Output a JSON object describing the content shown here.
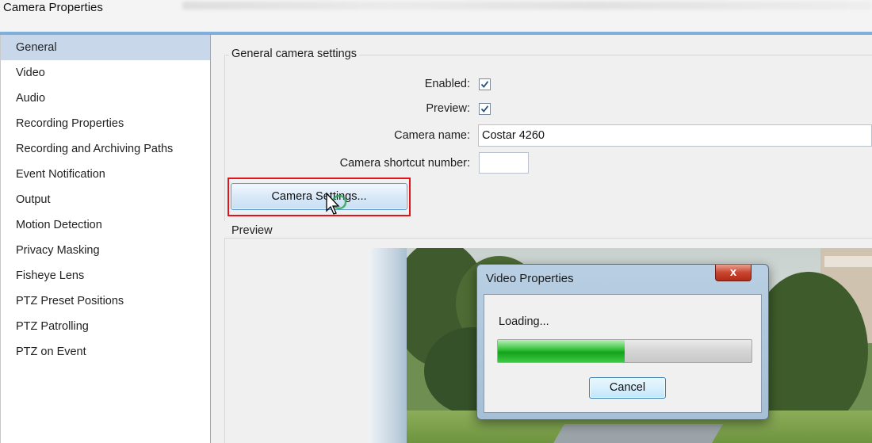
{
  "window": {
    "title": "Camera Properties"
  },
  "sidebar": {
    "items": [
      {
        "label": "General"
      },
      {
        "label": "Video"
      },
      {
        "label": "Audio"
      },
      {
        "label": "Recording Properties"
      },
      {
        "label": "Recording and Archiving Paths"
      },
      {
        "label": "Event Notification"
      },
      {
        "label": "Output"
      },
      {
        "label": "Motion Detection"
      },
      {
        "label": "Privacy Masking"
      },
      {
        "label": "Fisheye Lens"
      },
      {
        "label": "PTZ Preset Positions"
      },
      {
        "label": "PTZ Patrolling"
      },
      {
        "label": "PTZ on Event"
      }
    ],
    "selected": "General"
  },
  "general": {
    "group_title": "General camera settings",
    "enabled_label": "Enabled:",
    "enabled": true,
    "preview_label": "Preview:",
    "preview": true,
    "camera_name_label": "Camera name:",
    "camera_name_value": "Costar 4260",
    "shortcut_label": "Camera shortcut number:",
    "shortcut_value": "",
    "camera_settings_button": "Camera Settings..."
  },
  "preview": {
    "group_title": "Preview"
  },
  "dialog": {
    "title": "Video Properties",
    "close_label": "x",
    "status": "Loading...",
    "progress": 0.5,
    "cancel_label": "Cancel"
  },
  "colors": {
    "accent": "#7fb0dc",
    "selection": "#c8d8ea",
    "highlight": "#e0141a",
    "progress": "#14a21c"
  }
}
